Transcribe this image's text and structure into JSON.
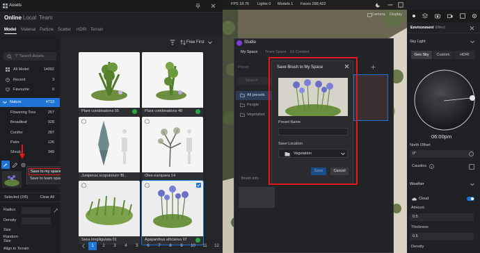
{
  "assets": {
    "title": "Assets",
    "source_tabs": [
      "Online",
      "Local",
      "Team"
    ],
    "category_tabs": [
      "Model",
      "Material",
      "Particle",
      "Scatter",
      "HDRI",
      "Terrain"
    ],
    "search_placeholder": "\"/\" Search Assets",
    "sidebar": [
      {
        "label": "All Model",
        "count": "14092"
      },
      {
        "label": "Recent",
        "count": "3"
      },
      {
        "label": "Favourite",
        "count": "0"
      }
    ],
    "nature": {
      "label": "Nature",
      "count": "4713"
    },
    "subcategories": [
      {
        "label": "Flowering Tree",
        "count": "257"
      },
      {
        "label": "Broadleaf",
        "count": "928"
      },
      {
        "label": "Conifer",
        "count": "287"
      },
      {
        "label": "Palm",
        "count": "126"
      },
      {
        "label": "Shrub",
        "count": "349"
      }
    ],
    "context_menu": {
      "save_my": "Save to my space",
      "save_team": "Save to team space"
    },
    "selected": {
      "label": "Selected (2/6)",
      "clear": "Clear All"
    },
    "params": [
      "Radius",
      "Density",
      "Size",
      "Random Size",
      "Align to Terrain"
    ],
    "sort": "Free First",
    "cards": [
      {
        "caption": "Plant combinations 55"
      },
      {
        "caption": "Plant combinations 48"
      },
      {
        "caption": "Juniperus scopulorum 'Bl..."
      },
      {
        "caption": "Olea europaea 14"
      },
      {
        "caption": "Sasa longiligulata 01"
      },
      {
        "caption": "Agapanthus africanus 07"
      }
    ],
    "pages": [
      "1",
      "2",
      "3",
      "4",
      "5",
      "6",
      "7",
      "8",
      "9",
      "10",
      "11",
      "12"
    ]
  },
  "viewport": {
    "fps": "FPS 18.76",
    "lights": "Lights 0",
    "models": "Models 1",
    "faces": "Faces 288,422",
    "camera": "Camera",
    "display": "Display"
  },
  "studio": {
    "title": "Studio",
    "tabs": [
      "My Space",
      "Team Space",
      "Eli Created"
    ],
    "preset_head": "Preset",
    "search_placeholder": "Search",
    "presets": [
      "All presets",
      "People",
      "Vegetation"
    ],
    "brush_info": "Brush info"
  },
  "modal": {
    "title": "Save Brush to My Space",
    "preset_name_label": "Preset Name",
    "preset_name_value": "",
    "save_location_label": "Save Location",
    "save_location_value": "Vegetation",
    "save": "Save",
    "cancel": "Cancel"
  },
  "environment": {
    "tabs": [
      "Environment",
      "Effect"
    ],
    "sky_light": "Sky Light",
    "sky_modes": [
      "Geo Sky",
      "Custom",
      "HDRI"
    ],
    "time": "06:00pm",
    "north_offset_label": "North Offset",
    "north_offset_value": "0°",
    "caustics": "Caustics",
    "weather": "Weather",
    "cloud": "Cloud",
    "amount_label": "Amount",
    "amount_value": "0.5",
    "thickness_label": "Thickness",
    "thickness_value": "0.5",
    "density_label": "Density"
  },
  "colors": {
    "accent": "#1f74d6",
    "highlight": "#e0191f",
    "success": "#28a745"
  }
}
